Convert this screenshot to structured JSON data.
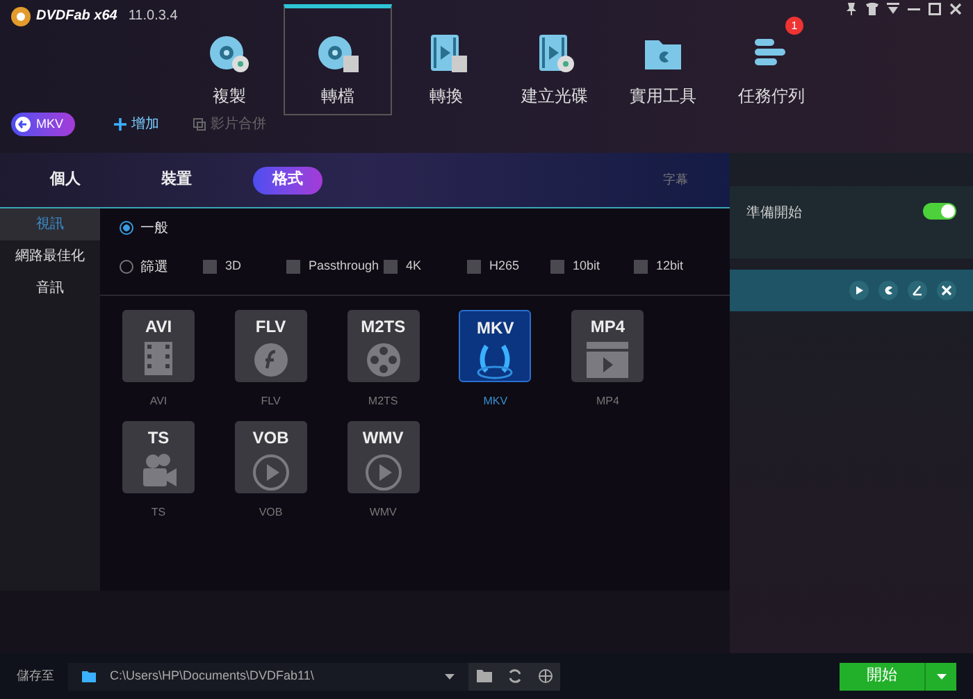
{
  "app": {
    "name": "DVDFab x64",
    "version": "11.0.3.4"
  },
  "nav": [
    {
      "label": "複製",
      "kind": "disc",
      "selected": false
    },
    {
      "label": "轉檔",
      "kind": "discfilm",
      "selected": true
    },
    {
      "label": "轉換",
      "kind": "film",
      "selected": false
    },
    {
      "label": "建立光碟",
      "kind": "filmdisc",
      "selected": false
    },
    {
      "label": "實用工具",
      "kind": "folder",
      "selected": false
    },
    {
      "label": "任務佇列",
      "kind": "queue",
      "selected": false,
      "badge": "1"
    }
  ],
  "toolbar": {
    "profile": "MKV",
    "add": "增加",
    "merge": {
      "label": "影片合併",
      "disabled": true
    }
  },
  "background_header": {
    "column_2": "字幕"
  },
  "popup": {
    "tabs": [
      {
        "label": "個人",
        "selected": false
      },
      {
        "label": "裝置",
        "selected": false
      },
      {
        "label": "格式",
        "selected": true
      }
    ],
    "categories": [
      {
        "label": "視訊",
        "selected": true
      },
      {
        "label": "網路最佳化",
        "selected": false
      },
      {
        "label": "音訊",
        "selected": false
      }
    ],
    "modes": [
      {
        "label": "一般",
        "selected": true
      },
      {
        "label": "篩選",
        "selected": false
      }
    ],
    "filters": [
      {
        "label": "3D",
        "checked": false
      },
      {
        "label": "Passthrough",
        "checked": false
      },
      {
        "label": "4K",
        "checked": false
      },
      {
        "label": "H265",
        "checked": false
      },
      {
        "label": "10bit",
        "checked": false
      },
      {
        "label": "12bit",
        "checked": false
      }
    ],
    "formats": [
      {
        "title": "AVI",
        "label": "AVI",
        "kind": "film",
        "selected": false
      },
      {
        "title": "FLV",
        "label": "FLV",
        "kind": "flash",
        "selected": false
      },
      {
        "title": "M2TS",
        "label": "M2TS",
        "kind": "reel",
        "selected": false
      },
      {
        "title": "MKV",
        "label": "MKV",
        "kind": "mkv",
        "selected": true
      },
      {
        "title": "MP4",
        "label": "MP4",
        "kind": "clapper",
        "selected": false
      },
      {
        "title": "TS",
        "label": "TS",
        "kind": "camera",
        "selected": false
      },
      {
        "title": "VOB",
        "label": "VOB",
        "kind": "play",
        "selected": false
      },
      {
        "title": "WMV",
        "label": "WMV",
        "kind": "play",
        "selected": false
      }
    ]
  },
  "task": {
    "status": "準備開始",
    "on": true
  },
  "bottom": {
    "save_label": "儲存至",
    "path": "C:\\Users\\HP\\Documents\\DVDFab11\\",
    "start": "開始"
  }
}
